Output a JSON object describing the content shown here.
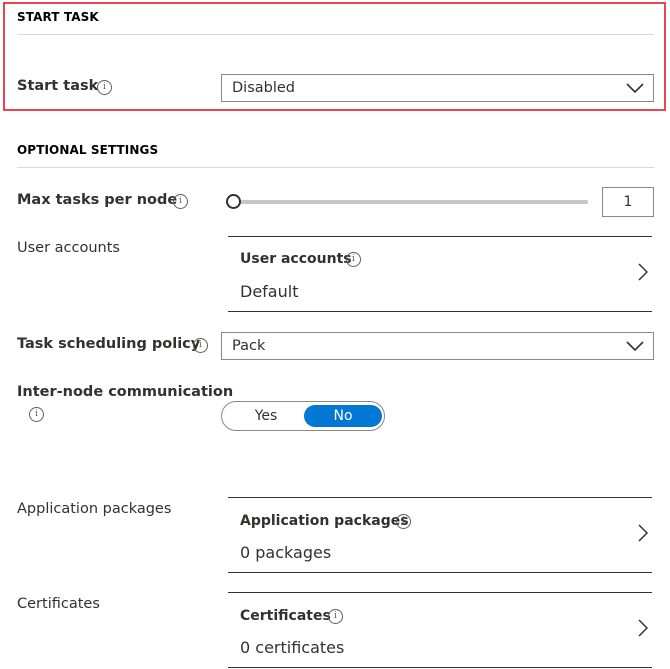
{
  "start_task": {
    "section_title": "START TASK",
    "label": "Start task",
    "dropdown_value": "Disabled"
  },
  "optional": {
    "section_title": "OPTIONAL SETTINGS",
    "max_tasks": {
      "label": "Max tasks per node",
      "value": "1",
      "slider_fraction": 0
    },
    "user_accounts": {
      "label": "User accounts",
      "blade_title": "User accounts",
      "blade_value": "Default"
    },
    "task_scheduling": {
      "label": "Task scheduling policy",
      "dropdown_value": "Pack"
    },
    "inter_node": {
      "label": "Inter-node communication",
      "yes_label": "Yes",
      "no_label": "No",
      "selected": "No"
    },
    "app_packages": {
      "label": "Application packages",
      "blade_title": "Application packages",
      "blade_value": "0 packages"
    },
    "certificates": {
      "label": "Certificates",
      "blade_title": "Certificates",
      "blade_value": "0 certificates"
    }
  },
  "icons": {
    "info": "info-icon",
    "dropdown": "chevron-down-icon",
    "blade": "chevron-right-icon"
  },
  "colors": {
    "highlight": "#e8464f",
    "accent": "#0078d4"
  }
}
